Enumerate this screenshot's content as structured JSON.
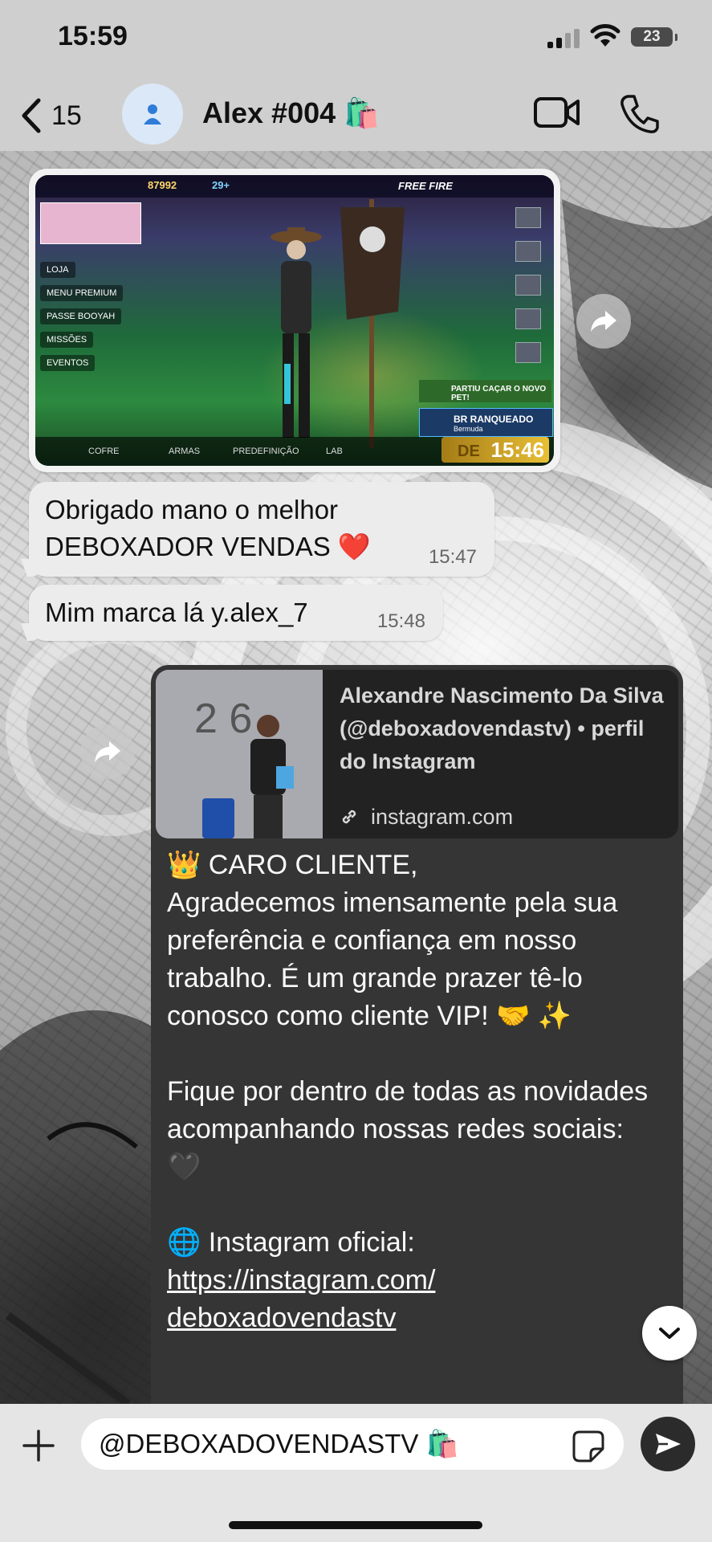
{
  "status_bar": {
    "time": "15:59",
    "battery": "23"
  },
  "header": {
    "back_count": "15",
    "contact_name": "Alex #004 🛍️",
    "icons": [
      "chevron-left-icon",
      "person-icon",
      "video-icon",
      "phone-icon"
    ]
  },
  "messages": {
    "media": {
      "game_hud": {
        "coins": "87992",
        "diamonds": "29+",
        "logo": "FREE FIRE",
        "menu": [
          "LOJA",
          "MENU PREMIUM",
          "PASSE BOOYAH",
          "MISSÕES",
          "EVENTOS"
        ],
        "bottom": [
          "COFRE",
          "ARMAS",
          "PREDEFINIÇÃO",
          "LAB"
        ],
        "party": "PARTIU CAÇAR O NOVO PET!",
        "rank": "BR RANQUEADO",
        "rank_sub": "Bermuda",
        "clock_prefix": "DE",
        "clock": "15:46"
      }
    },
    "msg1": {
      "text": "Obrigado mano o melhor DEBOXADOR VENDAS ❤️",
      "time": "15:47"
    },
    "msg2": {
      "text": "Mim marca lá y.alex_7",
      "time": "15:48"
    },
    "outgoing": {
      "preview_title": "Alexandre Nascimento Da Silva (@deboxadovendastv) • perfil do Instagram",
      "preview_domain": "instagram.com",
      "para1": "👑 CARO CLIENTE,",
      "para2": "Agradecemos imensamente pela sua preferência e confiança em nosso trabalho. É um grande prazer tê-lo conosco como cliente VIP! 🤝 ✨",
      "para3": "Fique por dentro de todas as novidades acompanhando nossas redes sociais: 🖤",
      "para4": "🌐 Instagram oficial:",
      "link": "https://instagram.com/ deboxadovendastv"
    }
  },
  "composer": {
    "input_value": "@DEBOXADOVENDASTV 🛍️"
  },
  "colors": {
    "incoming_bubble": "#ececec",
    "outgoing_bubble": "#353535",
    "send_button": "#2b2b2b"
  }
}
